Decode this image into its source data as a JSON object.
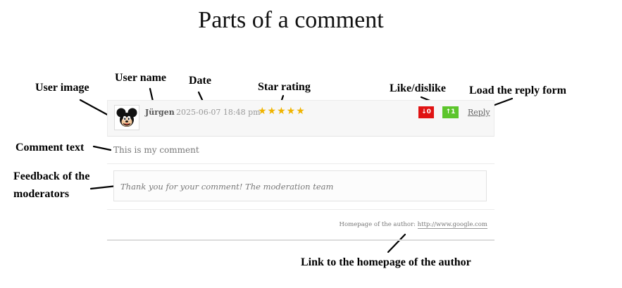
{
  "title": "Parts of a comment",
  "annotations": {
    "user_image": "User image",
    "user_name": "User name",
    "date": "Date",
    "star_rating": "Star rating",
    "like_dislike": "Like/dislike",
    "reply_form": "Load the reply form",
    "comment_text": "Comment text",
    "feedback_line1": "Feedback of the",
    "feedback_line2": "moderators",
    "homepage_link": "Link to the homepage of the author"
  },
  "comment": {
    "avatar_icon": "mickey-mouse-avatar",
    "user_name": "Jürgen",
    "date": "2025-06-07 18:48 pm",
    "stars": "★★★★★",
    "rating_stars": 5,
    "dislike": "↓0",
    "like": "↑1",
    "reply": "Reply",
    "text": "This is my comment",
    "moderator_feedback": "Thank you for your comment! The moderation team",
    "homepage_label": "Homepage of the author:",
    "homepage_url": "http://www.google.com"
  },
  "colors": {
    "dislike": "#e01313",
    "like": "#5cc52b",
    "stars": "#f0b400"
  }
}
